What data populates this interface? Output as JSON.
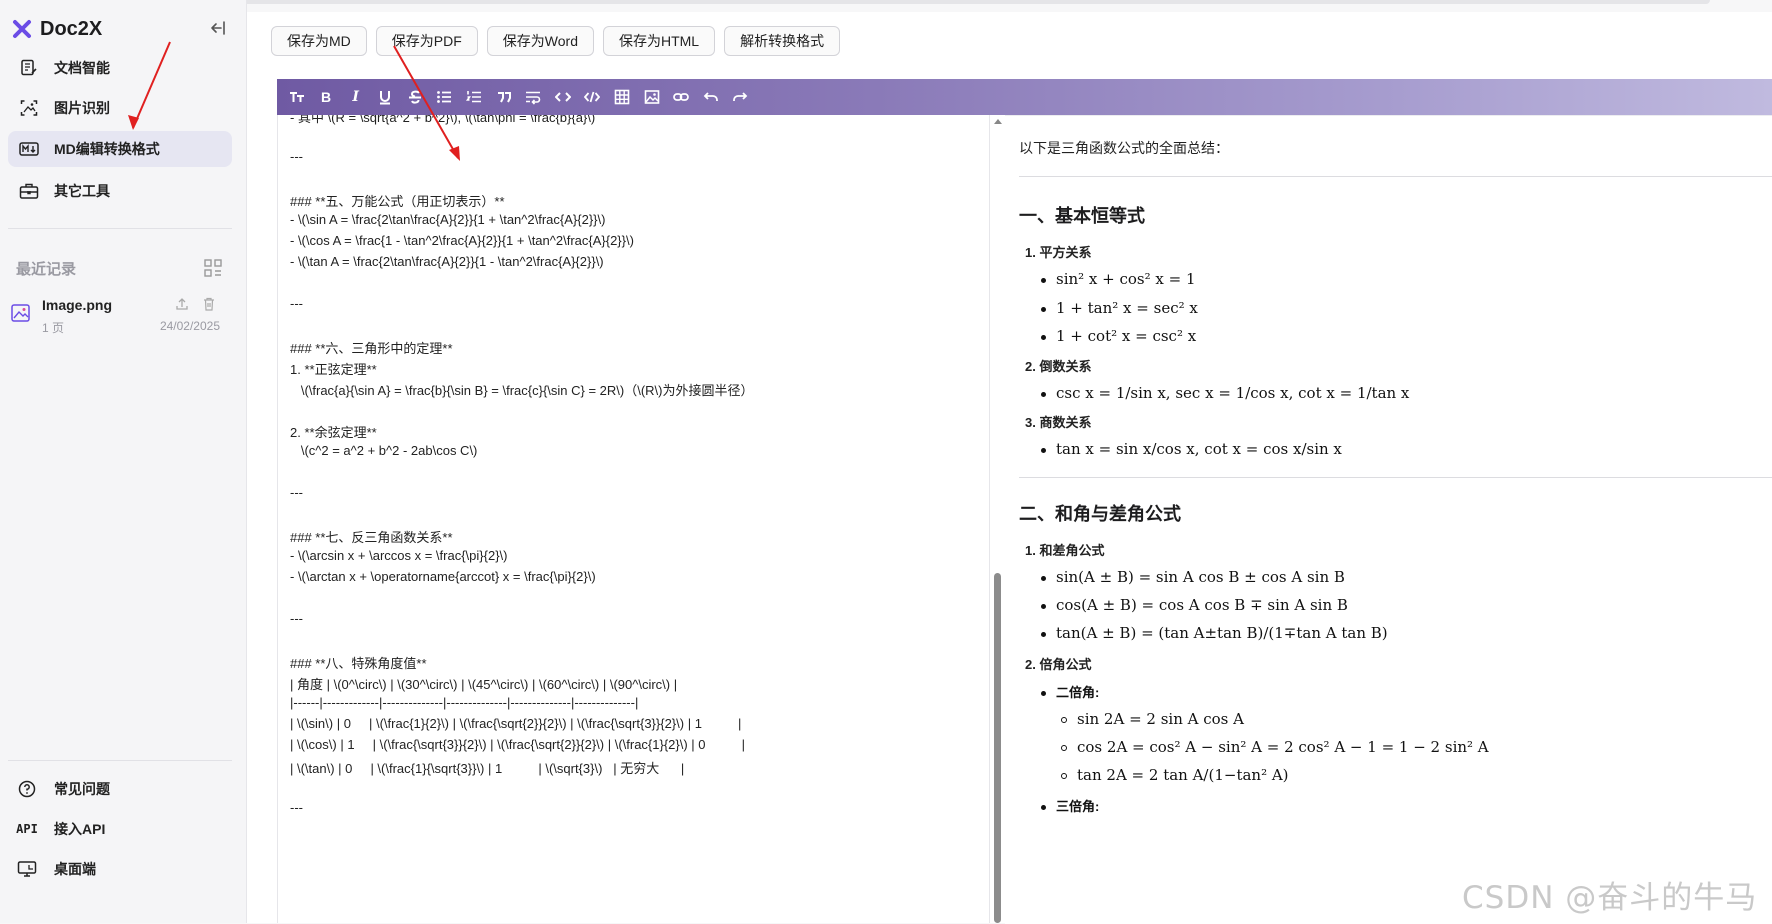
{
  "brand": {
    "name": "Doc2X"
  },
  "sidebar": {
    "nav": [
      {
        "label": "文档智能"
      },
      {
        "label": "图片识别"
      },
      {
        "label": "MD编辑转换格式"
      },
      {
        "label": "其它工具"
      }
    ],
    "recent_title": "最近记录",
    "record": {
      "filename": "Image.png",
      "pages": "1 页",
      "date": "24/02/2025"
    },
    "bottom": [
      {
        "label": "常见问题",
        "icon": "question-circle-icon"
      },
      {
        "label": "接入API",
        "icon_text": "API"
      },
      {
        "label": "桌面端",
        "icon": "desktop-icon"
      }
    ]
  },
  "actions": [
    "保存为MD",
    "保存为PDF",
    "保存为Word",
    "保存为HTML",
    "解析转换格式"
  ],
  "toolbar": {
    "tools": [
      "heading-icon",
      "bold-icon",
      "italic-icon",
      "underline-icon",
      "strikethrough-icon",
      "bullet-list-icon",
      "ordered-list-icon",
      "quote-icon",
      "wrap-icon",
      "code-icon",
      "code-block-icon",
      "table-icon",
      "image-icon",
      "link-icon",
      "undo-icon",
      "redo-icon"
    ],
    "gradient": [
      "#6f5aa3",
      "#c0badf"
    ]
  },
  "editor": {
    "lines": [
      "- 其中 \\(R = \\sqrt{a^2 + b^2}\\), \\(\\tan\\phi = \\frac{b}{a}\\)",
      "",
      "---",
      "",
      "### **五、万能公式（用正切表示）**",
      "- \\(\\sin A = \\frac{2\\tan\\frac{A}{2}}{1 + \\tan^2\\frac{A}{2}}\\)",
      "- \\(\\cos A = \\frac{1 - \\tan^2\\frac{A}{2}}{1 + \\tan^2\\frac{A}{2}}\\)",
      "- \\(\\tan A = \\frac{2\\tan\\frac{A}{2}}{1 - \\tan^2\\frac{A}{2}}\\)",
      "",
      "---",
      "",
      "### **六、三角形中的定理**",
      "1. **正弦定理**",
      "   \\(\\frac{a}{\\sin A} = \\frac{b}{\\sin B} = \\frac{c}{\\sin C} = 2R\\)（\\(R\\)为外接圆半径）",
      "",
      "2. **余弦定理**",
      "   \\(c^2 = a^2 + b^2 - 2ab\\cos C\\)",
      "",
      "---",
      "",
      "### **七、反三角函数关系**",
      "- \\(\\arcsin x + \\arccos x = \\frac{\\pi}{2}\\)",
      "- \\(\\arctan x + \\operatorname{arccot} x = \\frac{\\pi}{2}\\)",
      "",
      "---",
      "",
      "### **八、特殊角度值**",
      "| 角度 | \\(0^\\circ\\) | \\(30^\\circ\\) | \\(45^\\circ\\) | \\(60^\\circ\\) | \\(90^\\circ\\) |",
      "|------|-------------|--------------|--------------|--------------|--------------|",
      "| \\(\\sin\\) | 0     | \\(\\frac{1}{2}\\) | \\(\\frac{\\sqrt{2}}{2}\\) | \\(\\frac{\\sqrt{3}}{2}\\) | 1          |",
      "| \\(\\cos\\) | 1     | \\(\\frac{\\sqrt{3}}{2}\\) | \\(\\frac{\\sqrt{2}}{2}\\) | \\(\\frac{1}{2}\\) | 0          |",
      "| \\(\\tan\\) | 0     | \\(\\frac{1}{\\sqrt{3}}\\) | 1          | \\(\\sqrt{3}\\)   | 无穷大      |",
      "",
      "---"
    ]
  },
  "preview": {
    "intro": "以下是三角函数公式的全面总结：",
    "sec1_title": "一、基本恒等式",
    "s1_h1": "1. 平方关系",
    "s1_l1": "sin² x + cos² x = 1",
    "s1_l2": "1 + tan² x = sec² x",
    "s1_l3": "1 + cot² x = csc² x",
    "s1_h2": "2. 倒数关系",
    "s1_l4": "csc x = 1/sin x,  sec x = 1/cos x,  cot x = 1/tan x",
    "s1_h3": "3. 商数关系",
    "s1_l5": "tan x = sin x/cos x,  cot x = cos x/sin x",
    "sec2_title": "二、和角与差角公式",
    "s2_h1": "1. 和差角公式",
    "s2_l1": "sin(A ± B) = sin A cos B ± cos A sin B",
    "s2_l2": "cos(A ± B) = cos A cos B ∓ sin A sin B",
    "s2_l3": "tan(A ± B) = (tan A±tan B)/(1∓tan A tan B)",
    "s2_h2": "2. 倍角公式",
    "s2_sub1": "二倍角:",
    "s2_l4": "sin 2A = 2 sin A cos A",
    "s2_l5": "cos 2A = cos² A − sin² A = 2 cos² A − 1 = 1 − 2 sin² A",
    "s2_l6": "tan 2A = 2 tan A/(1−tan² A)",
    "s2_sub2": "三倍角:"
  },
  "watermark": "CSDN @奋斗的牛马"
}
